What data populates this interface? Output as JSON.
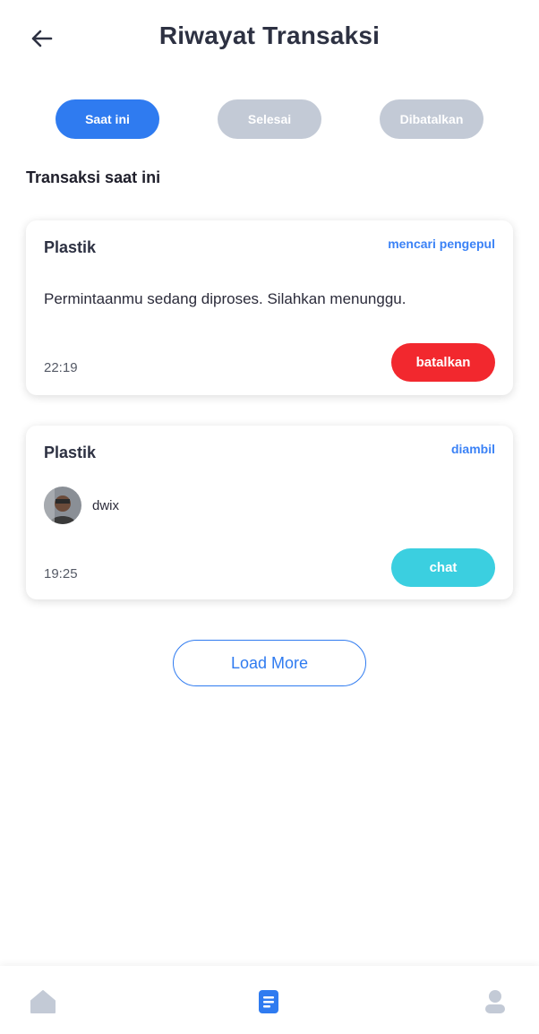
{
  "header": {
    "title": "Riwayat Transaksi",
    "back_icon": "arrow-left-icon"
  },
  "tabs": [
    {
      "label": "Saat ini",
      "active": true
    },
    {
      "label": "Selesai",
      "active": false
    },
    {
      "label": "Dibatalkan",
      "active": false
    }
  ],
  "section": {
    "title": "Transaksi saat ini"
  },
  "transactions": [
    {
      "category": "Plastik",
      "status": "mencari pengepul",
      "message": "Permintaanmu sedang diproses. Silahkan menunggu.",
      "time": "22:19",
      "action_label": "batalkan",
      "action_color": "#f2282e"
    },
    {
      "category": "Plastik",
      "status": "diambil",
      "collector_name": "dwix",
      "time": "19:25",
      "action_label": "chat",
      "action_color": "#3bcfe0"
    }
  ],
  "load_more": {
    "label": "Load More"
  },
  "bottom_nav": [
    {
      "icon": "home-icon",
      "active": false
    },
    {
      "icon": "document-icon",
      "active": true
    },
    {
      "icon": "user-icon",
      "active": false
    }
  ],
  "colors": {
    "primary": "#2f7bf0",
    "inactive": "#c3cad6",
    "danger": "#f2282e",
    "chat": "#3bcfe0"
  }
}
